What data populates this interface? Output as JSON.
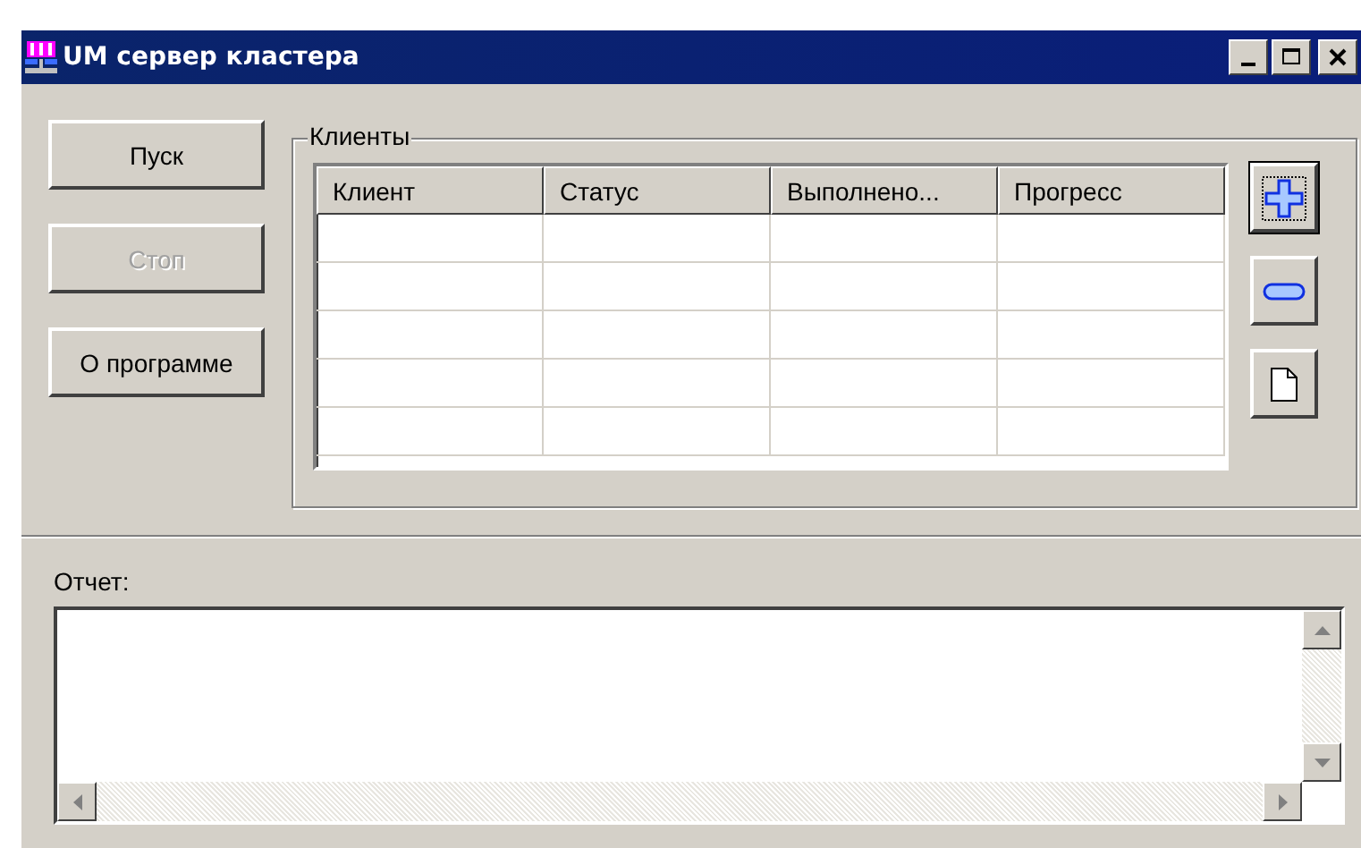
{
  "window": {
    "title": "UM сервер кластера"
  },
  "buttons": [
    {
      "label": "Пуск",
      "disabled": false
    },
    {
      "label": "Стоп",
      "disabled": true
    },
    {
      "label": "О программе",
      "disabled": false
    }
  ],
  "clients": {
    "title": "Клиенты",
    "columns": [
      "Клиент",
      "Статус",
      "Выполнено...",
      "Прогресс"
    ]
  },
  "report": {
    "label": "Отчет:"
  }
}
